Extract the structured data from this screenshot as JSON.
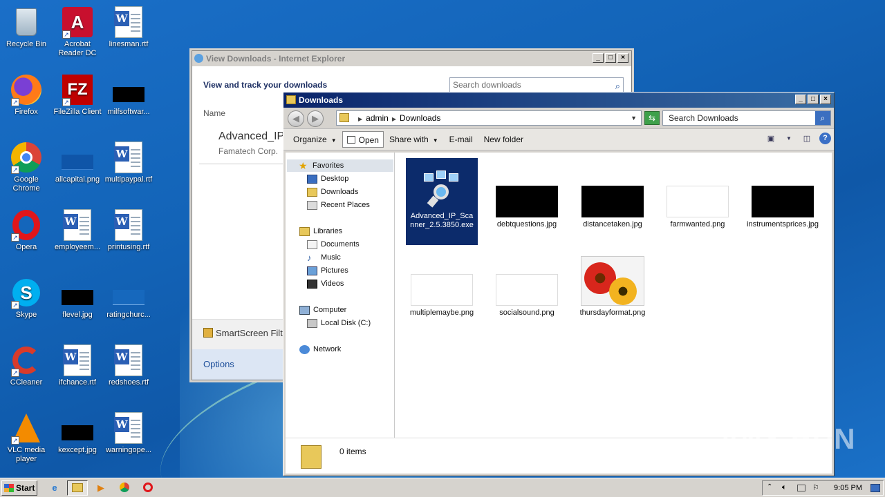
{
  "desktop": {
    "icons": [
      {
        "label": "Recycle Bin",
        "icon": "recycle-bin-icon"
      },
      {
        "label": "Acrobat Reader DC",
        "icon": "acrobat-icon"
      },
      {
        "label": "linesman.rtf",
        "icon": "word-document-icon"
      },
      {
        "label": "Firefox",
        "icon": "firefox-icon"
      },
      {
        "label": "FileZilla Client",
        "icon": "filezilla-icon"
      },
      {
        "label": "milfsoftwar...",
        "icon": "image-file-icon"
      },
      {
        "label": "Google Chrome",
        "icon": "chrome-icon"
      },
      {
        "label": "allcapital.png",
        "icon": "image-file-icon"
      },
      {
        "label": "multipaypal.rtf",
        "icon": "word-document-icon"
      },
      {
        "label": "Opera",
        "icon": "opera-icon"
      },
      {
        "label": "employeem...",
        "icon": "word-document-icon"
      },
      {
        "label": "printusing.rtf",
        "icon": "word-document-icon"
      },
      {
        "label": "Skype",
        "icon": "skype-icon"
      },
      {
        "label": "flevel.jpg",
        "icon": "image-file-icon"
      },
      {
        "label": "ratingchurc...",
        "icon": "image-file-icon"
      },
      {
        "label": "CCleaner",
        "icon": "ccleaner-icon"
      },
      {
        "label": "ifchance.rtf",
        "icon": "word-document-icon"
      },
      {
        "label": "redshoes.rtf",
        "icon": "word-document-icon"
      },
      {
        "label": "VLC media player",
        "icon": "vlc-icon"
      },
      {
        "label": "kexcept.jpg",
        "icon": "image-file-icon"
      },
      {
        "label": "warningope...",
        "icon": "word-document-icon"
      }
    ]
  },
  "ie_window": {
    "title": "View Downloads - Internet Explorer",
    "heading": "View and track your downloads",
    "search_placeholder": "Search downloads",
    "name_column": "Name",
    "download_name": "Advanced_IP",
    "download_publisher": "Famatech Corp.",
    "smartscreen": "SmartScreen Filte",
    "options": "Options"
  },
  "explorer": {
    "title": "Downloads",
    "breadcrumb": [
      "admin",
      "Downloads"
    ],
    "search_placeholder": "Search Downloads",
    "toolbar": {
      "organize": "Organize",
      "open": "Open",
      "share_with": "Share with",
      "email": "E-mail",
      "new_folder": "New folder"
    },
    "nav": {
      "favorites": "Favorites",
      "desktop": "Desktop",
      "downloads": "Downloads",
      "recent_places": "Recent Places",
      "libraries": "Libraries",
      "documents": "Documents",
      "music": "Music",
      "pictures": "Pictures",
      "videos": "Videos",
      "computer": "Computer",
      "local_disk": "Local Disk (C:)",
      "network": "Network"
    },
    "files": [
      {
        "name": "Advanced_IP_Scanner_2.5.3850.exe",
        "selected": true
      },
      {
        "name": "debtquestions.jpg"
      },
      {
        "name": "distancetaken.jpg"
      },
      {
        "name": "farmwanted.png"
      },
      {
        "name": "instrumentsprices.jpg"
      },
      {
        "name": "multiplemaybe.png"
      },
      {
        "name": "socialsound.png"
      },
      {
        "name": "thursdayformat.png"
      }
    ],
    "status": "0 items"
  },
  "watermark": "ANY RUN",
  "taskbar": {
    "start": "Start",
    "clock": "9:05 PM"
  }
}
